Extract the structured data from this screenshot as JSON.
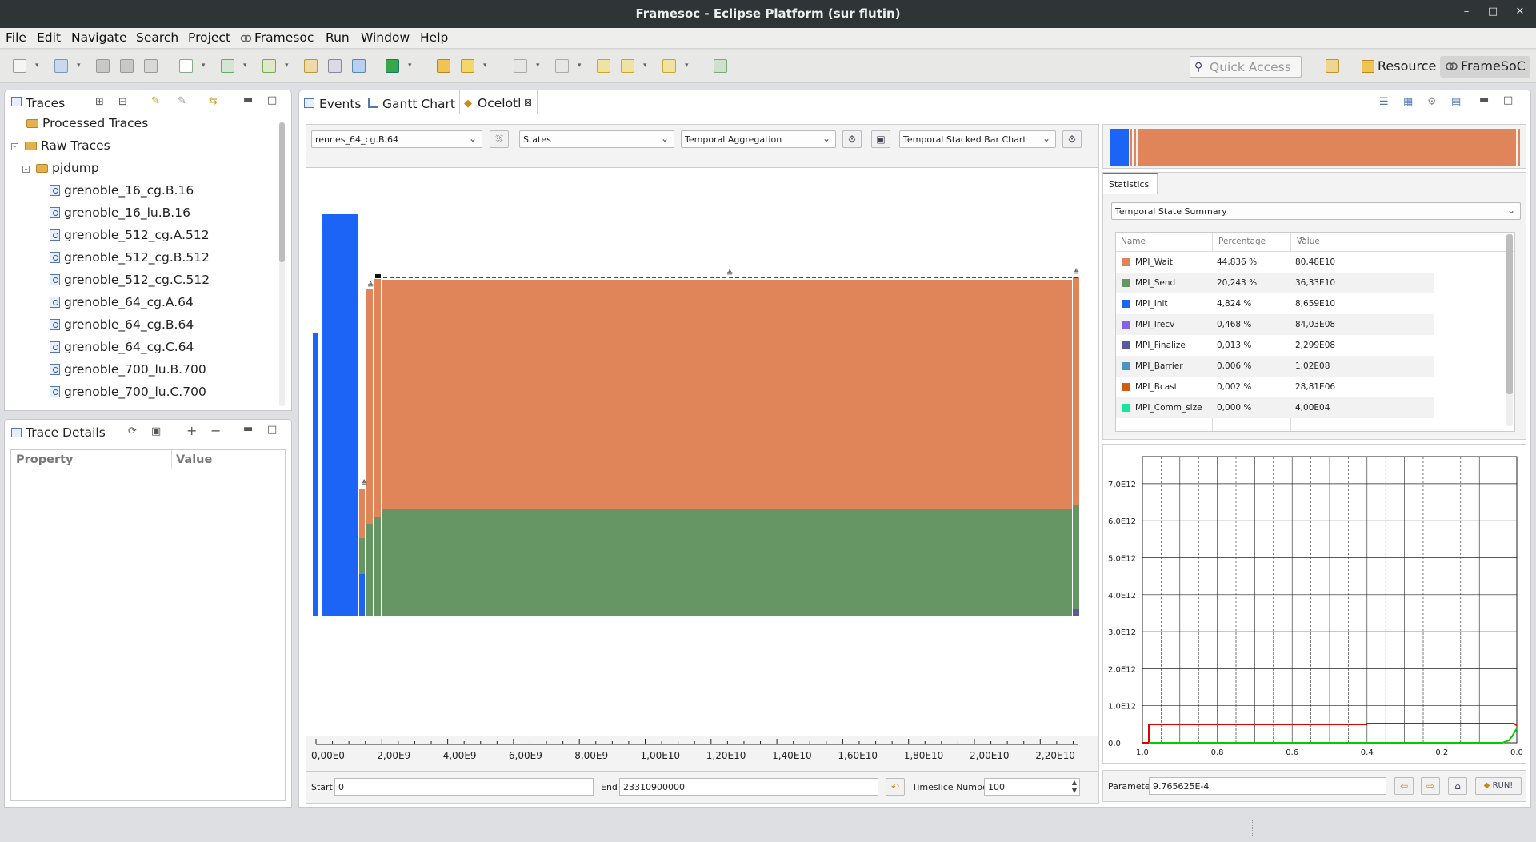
{
  "window": {
    "title": "Framesoc - Eclipse Platform  (sur flutin)",
    "minimize": "–",
    "maximize": "□",
    "close": "✕"
  },
  "menu": [
    "File",
    "Edit",
    "Navigate",
    "Search",
    "Project",
    "Framesoc",
    "Run",
    "Window",
    "Help"
  ],
  "toolbar": {
    "quick_access_placeholder": "Quick Access",
    "perspectives": [
      "Resource",
      "FrameSoC"
    ]
  },
  "traces_view": {
    "title": "Traces",
    "tree": [
      {
        "label": "Processed Traces",
        "level": 0,
        "type": "folder",
        "toggle": ""
      },
      {
        "label": "Raw Traces",
        "level": 0,
        "type": "folder",
        "toggle": "–"
      },
      {
        "label": "pjdump",
        "level": 1,
        "type": "folder",
        "toggle": "–"
      },
      {
        "label": "grenoble_16_cg.B.16",
        "level": 2,
        "type": "trace"
      },
      {
        "label": "grenoble_16_lu.B.16",
        "level": 2,
        "type": "trace"
      },
      {
        "label": "grenoble_512_cg.A.512",
        "level": 2,
        "type": "trace"
      },
      {
        "label": "grenoble_512_cg.B.512",
        "level": 2,
        "type": "trace"
      },
      {
        "label": "grenoble_512_cg.C.512",
        "level": 2,
        "type": "trace"
      },
      {
        "label": "grenoble_64_cg.A.64",
        "level": 2,
        "type": "trace"
      },
      {
        "label": "grenoble_64_cg.B.64",
        "level": 2,
        "type": "trace"
      },
      {
        "label": "grenoble_64_cg.C.64",
        "level": 2,
        "type": "trace"
      },
      {
        "label": "grenoble_700_lu.B.700",
        "level": 2,
        "type": "trace"
      },
      {
        "label": "grenoble_700_lu.C.700",
        "level": 2,
        "type": "trace"
      }
    ]
  },
  "trace_details": {
    "title": "Trace Details",
    "columns": [
      "Property",
      "Value"
    ]
  },
  "editor_tabs": [
    "Events",
    "Gantt Chart",
    "Ocelotl"
  ],
  "ocelotl": {
    "trace_select": "rennes_64_cg.B.64",
    "metric_select": "States",
    "aggregation_select": "Temporal Aggregation",
    "visualization_select": "Temporal Stacked Bar Chart",
    "start_label": "Start",
    "start_value": "0",
    "end_label": "End",
    "end_value": "23310900000",
    "timeslice_label": "Timeslice Number",
    "timeslice_value": "100",
    "x_axis_ticks": [
      "0,00E0",
      "2,00E9",
      "4,00E9",
      "6,00E9",
      "8,00E9",
      "1,00E10",
      "1,20E10",
      "1,40E10",
      "1,60E10",
      "1,80E10",
      "2,00E10",
      "2,20E10"
    ]
  },
  "statistics": {
    "tab": "Statistics",
    "summary_select": "Temporal State Summary",
    "columns": [
      "Name",
      "Percentage",
      "Value"
    ],
    "rows": [
      {
        "name": "MPI_Wait",
        "percentage": "44,836 %",
        "value": "80,48E10",
        "color": "#e0845a"
      },
      {
        "name": "MPI_Send",
        "percentage": "20,243 %",
        "value": "36,33E10",
        "color": "#679665"
      },
      {
        "name": "MPI_Init",
        "percentage": "4,824 %",
        "value": "8,659E10",
        "color": "#1c64f5"
      },
      {
        "name": "MPI_Irecv",
        "percentage": "0,468 %",
        "value": "84,03E08",
        "color": "#8464e6"
      },
      {
        "name": "MPI_Finalize",
        "percentage": "0,013 %",
        "value": "2,299E08",
        "color": "#5a5aa0"
      },
      {
        "name": "MPI_Barrier",
        "percentage": "0,006 %",
        "value": "1,02E08",
        "color": "#4b93c0"
      },
      {
        "name": "MPI_Bcast",
        "percentage": "0,002 %",
        "value": "28,81E06",
        "color": "#d35a14"
      },
      {
        "name": "MPI_Comm_size",
        "percentage": "0,000 %",
        "value": "4,00E04",
        "color": "#14e6a0"
      }
    ]
  },
  "quality_chart": {
    "y_ticks": [
      "0.0",
      "1,0E12",
      "2,0E12",
      "3,0E12",
      "4,0E12",
      "5,0E12",
      "6,0E12",
      "7,0E12"
    ],
    "x_ticks": [
      "1.0",
      "0.8",
      "0.6",
      "0.4",
      "0.2",
      "0.0"
    ]
  },
  "parameter": {
    "label": "Parameter",
    "value": "9.765625E-4",
    "run_label": "RUN!"
  },
  "colors": {
    "wait": "#e0845a",
    "send": "#679665",
    "init": "#1c64f5",
    "red_curve": "#e00000",
    "green_curve": "#00cc00"
  }
}
